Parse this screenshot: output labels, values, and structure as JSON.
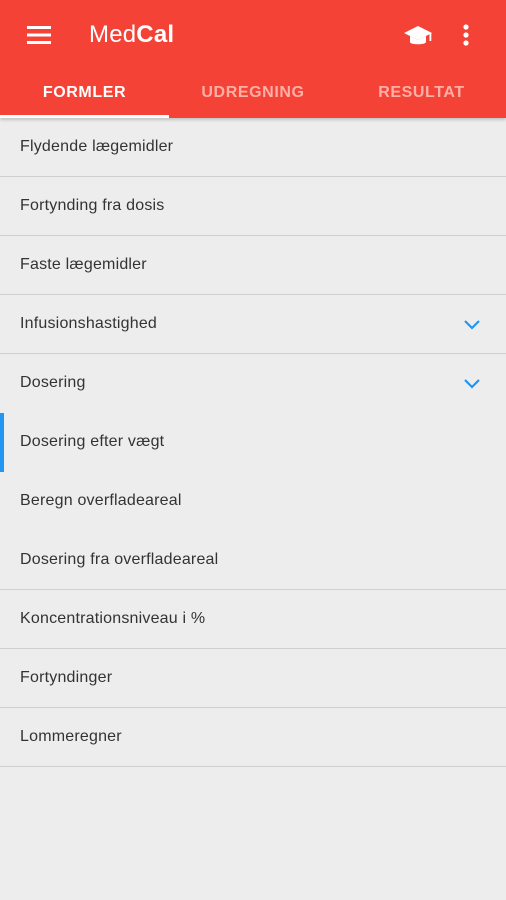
{
  "app": {
    "title_regular": "Med",
    "title_bold": "Cal"
  },
  "colors": {
    "appbar": "#f44336",
    "active_indicator": "#2196f3",
    "chevron": "#2196f3"
  },
  "header": {
    "menu_icon": "hamburger-menu-icon",
    "cap_icon": "graduation-cap-icon",
    "more_icon": "more-vertical-icon"
  },
  "tabs": [
    {
      "label": "FORMLER",
      "active": true
    },
    {
      "label": "UDREGNING",
      "active": false
    },
    {
      "label": "RESULTAT",
      "active": false
    }
  ],
  "list": {
    "items": [
      {
        "label": "Flydende lægemidler"
      },
      {
        "label": "Fortynding fra dosis"
      },
      {
        "label": "Faste lægemidler"
      },
      {
        "label": "Infusionshastighed",
        "expandable": true
      },
      {
        "label": "Dosering",
        "expandable": true,
        "children": [
          {
            "label": "Dosering efter vægt",
            "selected": true
          },
          {
            "label": "Beregn overfladeareal"
          },
          {
            "label": "Dosering fra overfladeareal"
          }
        ]
      },
      {
        "label": "Koncentrationsniveau i %"
      },
      {
        "label": "Fortyndinger"
      },
      {
        "label": "Lommeregner"
      }
    ]
  }
}
